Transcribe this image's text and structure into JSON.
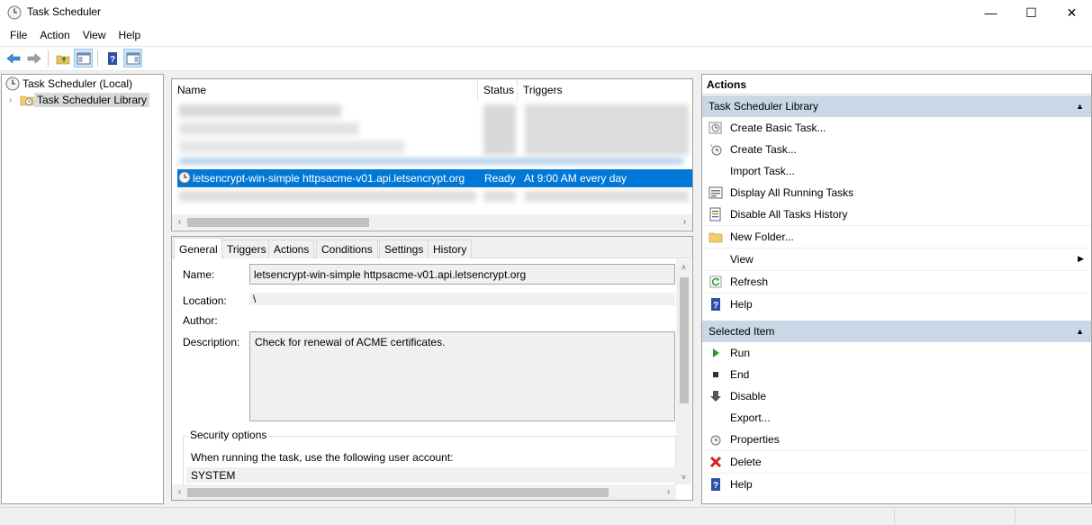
{
  "window": {
    "title": "Task Scheduler",
    "minimize_glyph": "—",
    "maximize_glyph": "☐",
    "close_glyph": "✕"
  },
  "menu": [
    "File",
    "Action",
    "View",
    "Help"
  ],
  "tree": {
    "root": "Task Scheduler (Local)",
    "library": "Task Scheduler Library"
  },
  "task_list": {
    "columns": [
      "Name",
      "Status",
      "Triggers"
    ],
    "selected_task": {
      "name": "letsencrypt-win-simple httpsacme-v01.api.letsencrypt.org",
      "status": "Ready",
      "trigger": "At 9:00 AM every day"
    }
  },
  "detail": {
    "tabs": [
      "General",
      "Triggers",
      "Actions",
      "Conditions",
      "Settings",
      "History"
    ],
    "active_tab": "General",
    "labels": {
      "name": "Name:",
      "location": "Location:",
      "author": "Author:",
      "description": "Description:"
    },
    "values": {
      "name": "letsencrypt-win-simple httpsacme-v01.api.letsencrypt.org",
      "location": "\\",
      "author": "",
      "description": "Check for renewal of ACME certificates."
    },
    "security": {
      "title": "Security options",
      "run_as_label": "When running the task, use the following user account:",
      "account": "SYSTEM"
    }
  },
  "actions": {
    "header": "Actions",
    "library_section": {
      "title": "Task Scheduler Library",
      "items": [
        {
          "label": "Create Basic Task...",
          "icon": "create-basic-task-icon"
        },
        {
          "label": "Create Task...",
          "icon": "create-task-icon"
        },
        {
          "label": "Import Task...",
          "icon": ""
        },
        {
          "label": "Display All Running Tasks",
          "icon": "running-tasks-icon"
        },
        {
          "label": "Disable All Tasks History",
          "icon": "history-icon"
        },
        {
          "label": "New Folder...",
          "icon": "folder-icon"
        },
        {
          "label": "View",
          "icon": ""
        },
        {
          "label": "Refresh",
          "icon": "refresh-icon"
        },
        {
          "label": "Help",
          "icon": "help-icon"
        }
      ]
    },
    "selected_section": {
      "title": "Selected Item",
      "items": [
        {
          "label": "Run",
          "icon": "run-icon"
        },
        {
          "label": "End",
          "icon": "end-icon"
        },
        {
          "label": "Disable",
          "icon": "disable-icon"
        },
        {
          "label": "Export...",
          "icon": ""
        },
        {
          "label": "Properties",
          "icon": "properties-icon"
        },
        {
          "label": "Delete",
          "icon": "delete-icon"
        },
        {
          "label": "Help",
          "icon": "help-icon"
        }
      ]
    }
  },
  "colors": {
    "selection": "#0078d7",
    "section_header": "#c9d7e7",
    "run_green": "#2a9d2a",
    "delete_red": "#d42020",
    "help_blue": "#2c4fa8"
  }
}
